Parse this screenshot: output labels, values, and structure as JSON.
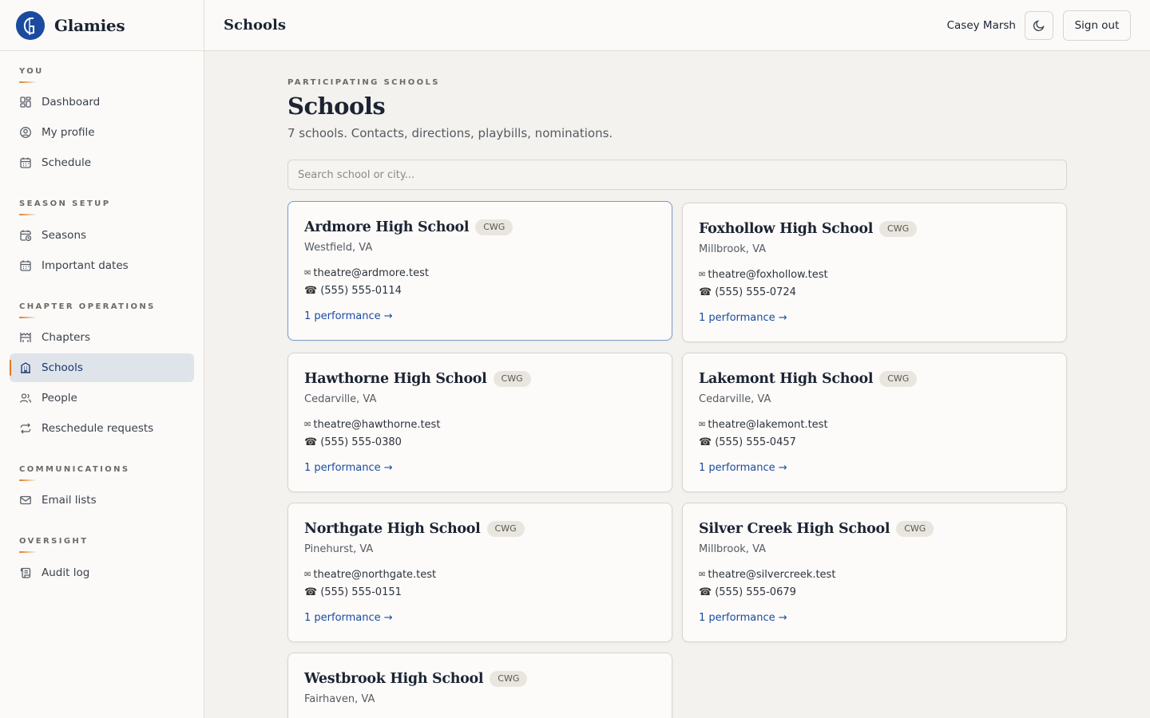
{
  "brand": {
    "name": "Glamies"
  },
  "topbar": {
    "title": "Schools",
    "user_name": "Casey Marsh",
    "theme_toggle_icon": "moon-icon",
    "signout_label": "Sign out"
  },
  "sidebar": {
    "sections": [
      {
        "title": "YOU",
        "items": [
          {
            "label": "Dashboard",
            "icon": "dashboard-icon"
          },
          {
            "label": "My profile",
            "icon": "user-circle-icon"
          },
          {
            "label": "Schedule",
            "icon": "calendar-icon"
          }
        ]
      },
      {
        "title": "SEASON SETUP",
        "items": [
          {
            "label": "Seasons",
            "icon": "calendar-clock-icon"
          },
          {
            "label": "Important dates",
            "icon": "calendar-icon"
          }
        ]
      },
      {
        "title": "CHAPTER OPERATIONS",
        "items": [
          {
            "label": "Chapters",
            "icon": "theater-icon"
          },
          {
            "label": "Schools",
            "icon": "building-icon",
            "active": true
          },
          {
            "label": "People",
            "icon": "users-icon"
          },
          {
            "label": "Reschedule requests",
            "icon": "repeat-icon"
          }
        ]
      },
      {
        "title": "COMMUNICATIONS",
        "items": [
          {
            "label": "Email lists",
            "icon": "mail-icon"
          }
        ]
      },
      {
        "title": "OVERSIGHT",
        "items": [
          {
            "label": "Audit log",
            "icon": "scroll-icon"
          }
        ]
      }
    ]
  },
  "main": {
    "eyebrow": "PARTICIPATING SCHOOLS",
    "title": "Schools",
    "subtitle": "7 schools. Contacts, directions, playbills, nominations.",
    "search_placeholder": "Search school or city..."
  },
  "schools": [
    {
      "name": "Ardmore High School",
      "badge": "CWG",
      "city": "Westfield, VA",
      "email": "theatre@ardmore.test",
      "phone": "(555) 555-0114",
      "link": "1 performance →"
    },
    {
      "name": "Foxhollow High School",
      "badge": "CWG",
      "city": "Millbrook, VA",
      "email": "theatre@foxhollow.test",
      "phone": "(555) 555-0724",
      "link": "1 performance →"
    },
    {
      "name": "Hawthorne High School",
      "badge": "CWG",
      "city": "Cedarville, VA",
      "email": "theatre@hawthorne.test",
      "phone": "(555) 555-0380",
      "link": "1 performance →"
    },
    {
      "name": "Lakemont High School",
      "badge": "CWG",
      "city": "Cedarville, VA",
      "email": "theatre@lakemont.test",
      "phone": "(555) 555-0457",
      "link": "1 performance →"
    },
    {
      "name": "Northgate High School",
      "badge": "CWG",
      "city": "Pinehurst, VA",
      "email": "theatre@northgate.test",
      "phone": "(555) 555-0151",
      "link": "1 performance →"
    },
    {
      "name": "Silver Creek High School",
      "badge": "CWG",
      "city": "Millbrook, VA",
      "email": "theatre@silvercreek.test",
      "phone": "(555) 555-0679",
      "link": "1 performance →"
    },
    {
      "name": "Westbrook High School",
      "badge": "CWG",
      "city": "Fairhaven, VA",
      "email": "",
      "phone": "",
      "link": ""
    }
  ],
  "icons": {
    "email": "✉",
    "phone": "☎"
  },
  "colors": {
    "accent": "#e07a1f",
    "brand_blue": "#1a4ba0",
    "active_bg": "#dfe3ea"
  }
}
